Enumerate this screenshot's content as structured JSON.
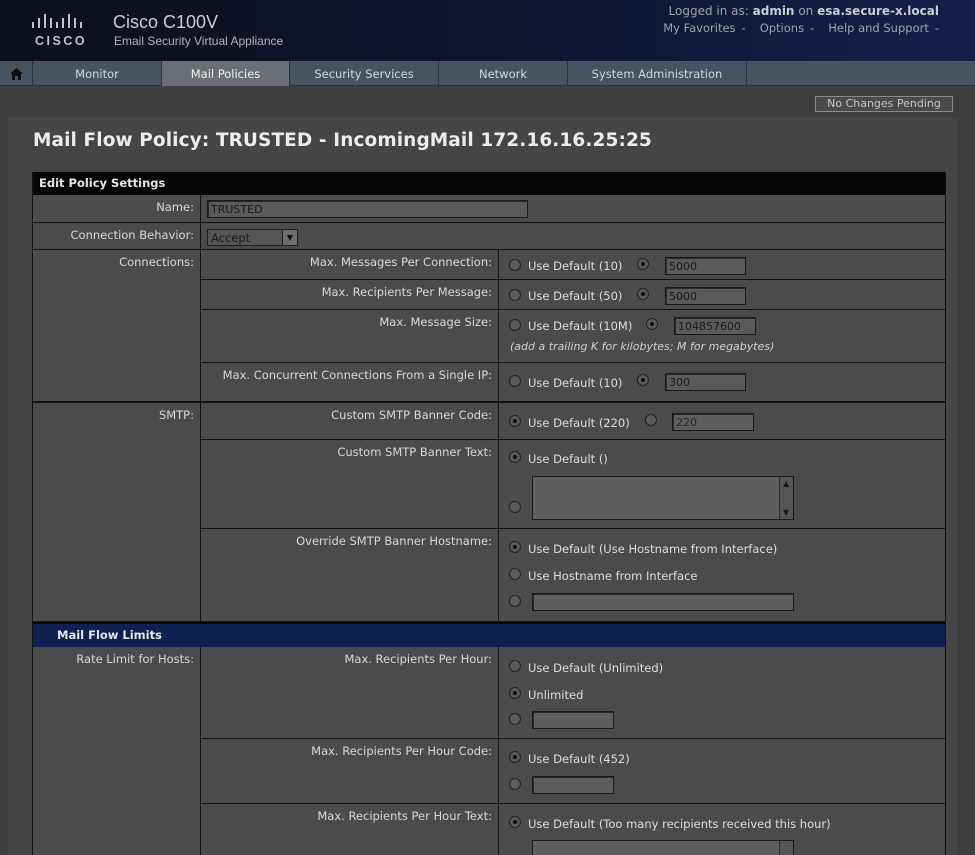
{
  "brand": {
    "logo_word": "CISCO",
    "product_name": "Cisco C100V",
    "product_subtitle": "Email Security Virtual Appliance"
  },
  "user": {
    "logged_in_prefix": "Logged in as:",
    "username": "admin",
    "on_text": "on",
    "hostname": "esa.secure-x.local"
  },
  "util_links": [
    "My Favorites",
    "Options",
    "Help and Support"
  ],
  "nav": {
    "home_icon": "home-icon",
    "tabs": [
      "Monitor",
      "Mail Policies",
      "Security Services",
      "Network",
      "System Administration"
    ],
    "active": "Mail Policies"
  },
  "pending_button": "No Changes Pending",
  "page_title": "Mail Flow Policy: TRUSTED - IncomingMail 172.16.16.25:25",
  "sections": {
    "edit_policy": "Edit Policy Settings",
    "mail_flow_limits": "Mail Flow Limits"
  },
  "name": {
    "label": "Name:",
    "value": "TRUSTED"
  },
  "connection_behavior": {
    "label": "Connection Behavior:",
    "value": "Accept"
  },
  "connections": {
    "label": "Connections:",
    "max_messages": {
      "label": "Max. Messages Per Connection:",
      "default": "Use Default (10)",
      "value": "5000"
    },
    "max_recipients": {
      "label": "Max. Recipients Per Message:",
      "default": "Use Default (50)",
      "value": "5000"
    },
    "max_size": {
      "label": "Max. Message Size:",
      "default": "Use Default (10M)",
      "value": "104857600",
      "note": "(add a trailing K for kilobytes; M for megabytes)"
    },
    "max_concurrent": {
      "label": "Max. Concurrent Connections From a Single IP:",
      "default": "Use Default (10)",
      "value": "300"
    }
  },
  "smtp": {
    "label": "SMTP:",
    "banner_code": {
      "label": "Custom SMTP Banner Code:",
      "default": "Use Default (220)",
      "value": "220"
    },
    "banner_text": {
      "label": "Custom SMTP Banner Text:",
      "default": "Use Default ()"
    },
    "banner_hostname": {
      "label": "Override SMTP Banner Hostname:",
      "default": "Use Default (Use Hostname from Interface)",
      "option2": "Use Hostname from Interface"
    }
  },
  "rate_limit": {
    "label": "Rate Limit for Hosts:",
    "recipients_per_hour": {
      "label": "Max. Recipients Per Hour:",
      "default": "Use Default (Unlimited)",
      "option2": "Unlimited"
    },
    "recipients_per_hour_code": {
      "label": "Max. Recipients Per Hour Code:",
      "default": "Use Default (452)"
    },
    "recipients_per_hour_text": {
      "label": "Max. Recipients Per Hour Text:",
      "default": "Use Default (Too many recipients received this hour)"
    }
  }
}
